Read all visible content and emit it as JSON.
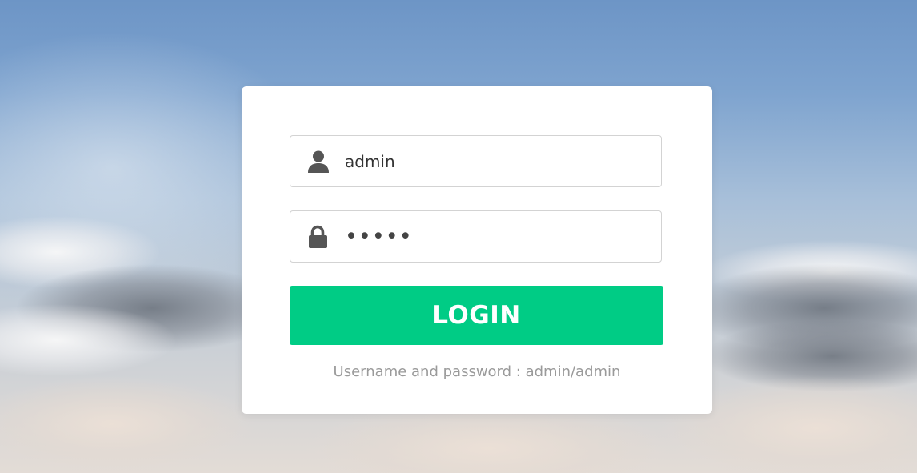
{
  "login": {
    "username": {
      "value": "admin",
      "icon": "user-icon"
    },
    "password": {
      "value": "admin",
      "icon": "lock-icon"
    },
    "submit_label": "LOGIN",
    "hint": "Username and password : admin/admin"
  },
  "colors": {
    "accent": "#00cc85",
    "card": "#ffffff",
    "hint_text": "#9a9a9a"
  }
}
